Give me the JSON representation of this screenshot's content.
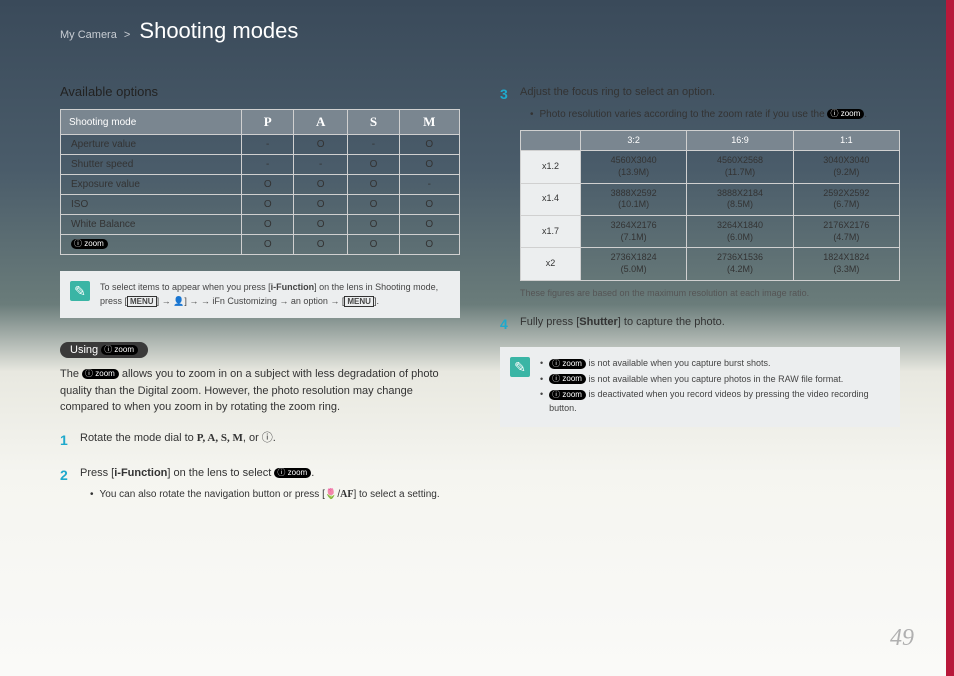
{
  "header": {
    "breadcrumb": "My Camera",
    "gt": ">",
    "title": "Shooting modes"
  },
  "left": {
    "h_options": "Available options",
    "opt_table": {
      "head": [
        "Shooting mode",
        "P",
        "A",
        "S",
        "M"
      ],
      "rows": [
        [
          "Aperture value",
          "-",
          "O",
          "-",
          "O"
        ],
        [
          "Shutter speed",
          "-",
          "-",
          "O",
          "O"
        ],
        [
          "Exposure value",
          "O",
          "O",
          "O",
          "-"
        ],
        [
          "ISO",
          "O",
          "O",
          "O",
          "O"
        ],
        [
          "White Balance",
          "O",
          "O",
          "O",
          "O"
        ]
      ],
      "izoom_row": [
        "O",
        "O",
        "O",
        "O"
      ]
    },
    "note1_a": "To select items to appear when you press [",
    "note1_b": "i-Function",
    "note1_c": "] on the lens in Shooting mode, press [",
    "note1_menu": "MENU",
    "note1_d": "] → ",
    "note1_e": " → iFn Customizing → an option → [",
    "note1_f": "].",
    "pill": "Using ",
    "izoom_text": "zoom",
    "intro_a": "The ",
    "intro_b": " allows you to zoom in on a subject with less degradation of photo quality than the Digital zoom. However, the photo resolution may change compared to when you zoom in by rotating the zoom ring.",
    "step1_num": "1",
    "step1_a": "Rotate the mode dial to ",
    "step1_modes": "P, A, S, M",
    "step1_b": ", or ",
    "step1_c": ".",
    "step2_num": "2",
    "step2_a": "Press [",
    "step2_b": "i-Function",
    "step2_c": "] on the lens to select ",
    "step2_d": ".",
    "step2_sub_a": "You can also rotate the navigation button or press [",
    "step2_sub_b": "AF",
    "step2_sub_c": "] to select a setting."
  },
  "right": {
    "step3_num": "3",
    "step3": "Adjust the focus ring to select an option.",
    "step3_sub_a": "Photo resolution varies according to the zoom rate if you use the ",
    "step3_sub_b": ".",
    "res_table": {
      "head": [
        "",
        "3:2",
        "16:9",
        "1:1"
      ],
      "rows": [
        {
          "label": "x1.2",
          "cells": [
            [
              "4560X3040",
              "(13.9M)"
            ],
            [
              "4560X2568",
              "(11.7M)"
            ],
            [
              "3040X3040",
              "(9.2M)"
            ]
          ]
        },
        {
          "label": "x1.4",
          "cells": [
            [
              "3888X2592",
              "(10.1M)"
            ],
            [
              "3888X2184",
              "(8.5M)"
            ],
            [
              "2592X2592",
              "(6.7M)"
            ]
          ]
        },
        {
          "label": "x1.7",
          "cells": [
            [
              "3264X2176",
              "(7.1M)"
            ],
            [
              "3264X1840",
              "(6.0M)"
            ],
            [
              "2176X2176",
              "(4.7M)"
            ]
          ]
        },
        {
          "label": "x2",
          "cells": [
            [
              "2736X1824",
              "(5.0M)"
            ],
            [
              "2736X1536",
              "(4.2M)"
            ],
            [
              "1824X1824",
              "(3.3M)"
            ]
          ]
        }
      ]
    },
    "caption": "These figures are based on the maximum resolution at each image ratio.",
    "step4_num": "4",
    "step4_a": "Fully press [",
    "step4_b": "Shutter",
    "step4_c": "] to capture the photo.",
    "note2_items": [
      " is not available when you capture burst shots.",
      " is not available when you capture photos in the RAW file format.",
      " is deactivated when you record videos by pressing the video recording button."
    ]
  },
  "page_num": "49"
}
